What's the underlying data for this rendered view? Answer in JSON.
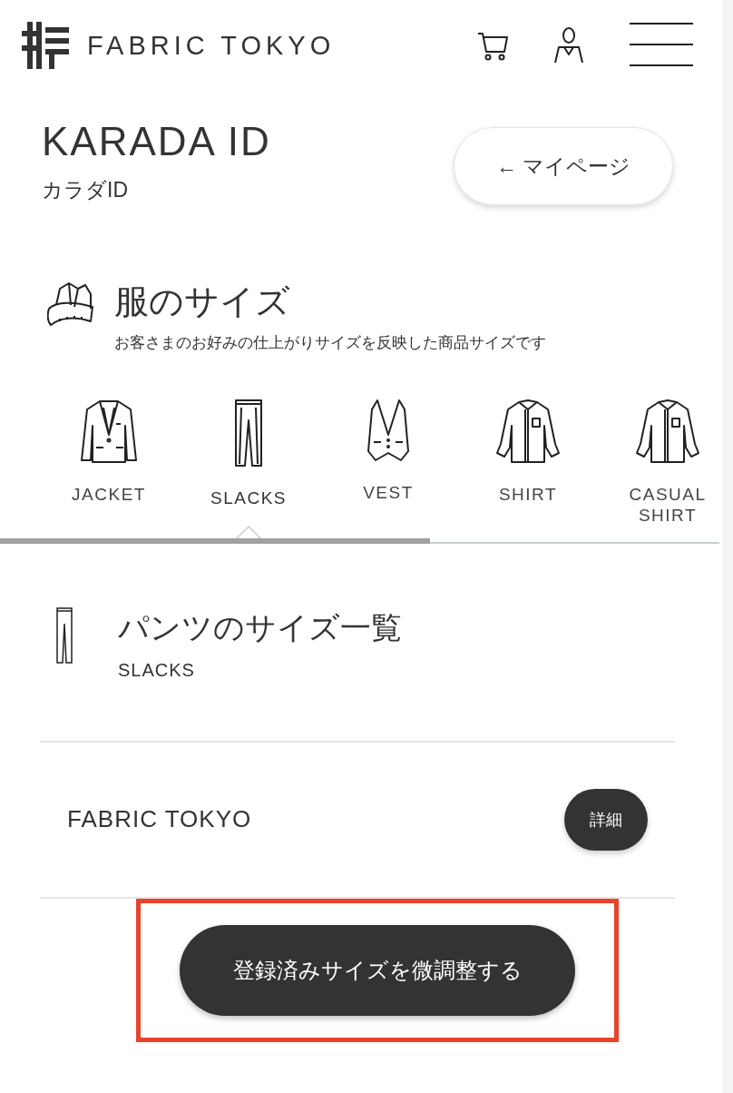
{
  "header": {
    "brand": "FABRIC TOKYO"
  },
  "page": {
    "title": "KARADA ID",
    "subtitle": "カラダID",
    "back_button": "← マイページ"
  },
  "section": {
    "title": "服のサイズ",
    "description": "お客さまのお好みの仕上がりサイズを反映した商品サイズです"
  },
  "tabs": [
    {
      "kind": "jacket",
      "label": "JACKET",
      "selected": false
    },
    {
      "kind": "slacks",
      "label": "SLACKS",
      "selected": true
    },
    {
      "kind": "vest",
      "label": "VEST",
      "selected": false
    },
    {
      "kind": "shirt",
      "label": "SHIRT",
      "selected": false
    },
    {
      "kind": "casual",
      "label": "CASUAL SHIRT",
      "selected": false
    }
  ],
  "size_list": {
    "title": "パンツのサイズ一覧",
    "subtitle": "SLACKS",
    "rows": [
      {
        "brand": "FABRIC TOKYO",
        "button": "詳細"
      }
    ]
  },
  "action": {
    "label": "登録済みサイズを微調整する",
    "highlighted": true
  }
}
